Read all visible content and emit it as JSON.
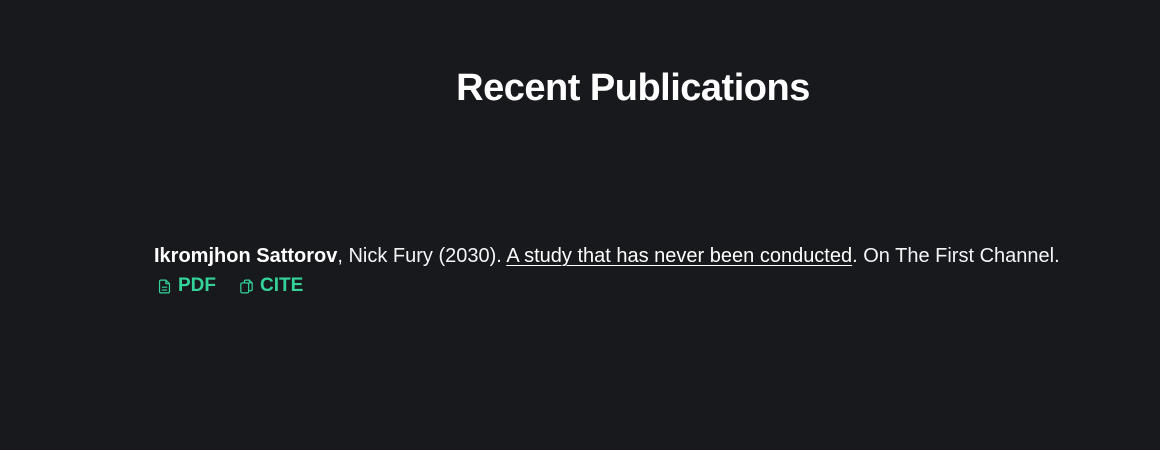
{
  "section": {
    "title": "Recent Publications"
  },
  "publication": {
    "author_main": "Ikromjhon Sattorov",
    "author_separator": ",",
    "coauthors_and_year": " Nick Fury (2030). ",
    "title": "A study that has never been conducted",
    "venue": ". On The First Channel.",
    "links": {
      "pdf_label": "PDF",
      "pdf_icon": "file-text-icon",
      "cite_label": "CITE",
      "cite_icon": "copy-icon"
    }
  },
  "colors": {
    "background": "#18191d",
    "text": "#f3f4f6",
    "accent": "#34d399"
  }
}
